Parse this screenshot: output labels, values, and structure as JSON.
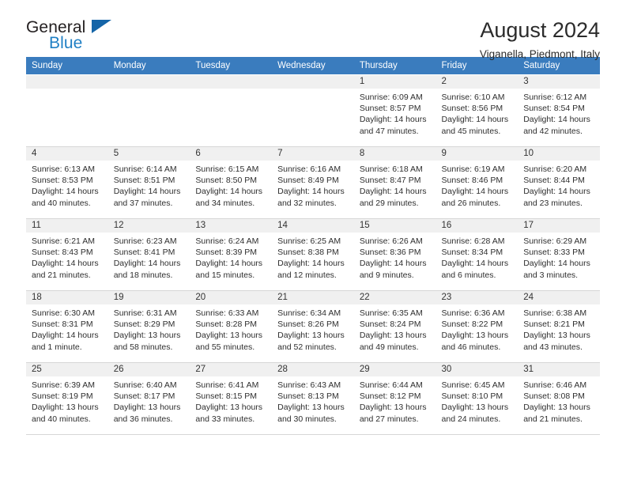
{
  "brand": {
    "name_part1": "General",
    "name_part2": "Blue",
    "flag_icon": "triangle-flag-icon"
  },
  "header": {
    "month_title": "August 2024",
    "location": "Viganella, Piedmont, Italy"
  },
  "colors": {
    "header_blue": "#3a7cbe",
    "brand_blue": "#1f7fc4",
    "flag_blue": "#1565a8",
    "daynum_bg": "#f0f0f0",
    "grid_line": "#d6d6d6"
  },
  "weekdays": [
    "Sunday",
    "Monday",
    "Tuesday",
    "Wednesday",
    "Thursday",
    "Friday",
    "Saturday"
  ],
  "weeks": [
    [
      {
        "empty": true,
        "day": "",
        "sunrise": "",
        "sunset": "",
        "daylight1": "",
        "daylight2": ""
      },
      {
        "empty": true,
        "day": "",
        "sunrise": "",
        "sunset": "",
        "daylight1": "",
        "daylight2": ""
      },
      {
        "empty": true,
        "day": "",
        "sunrise": "",
        "sunset": "",
        "daylight1": "",
        "daylight2": ""
      },
      {
        "empty": true,
        "day": "",
        "sunrise": "",
        "sunset": "",
        "daylight1": "",
        "daylight2": ""
      },
      {
        "empty": false,
        "day": "1",
        "sunrise": "Sunrise: 6:09 AM",
        "sunset": "Sunset: 8:57 PM",
        "daylight1": "Daylight: 14 hours",
        "daylight2": "and 47 minutes."
      },
      {
        "empty": false,
        "day": "2",
        "sunrise": "Sunrise: 6:10 AM",
        "sunset": "Sunset: 8:56 PM",
        "daylight1": "Daylight: 14 hours",
        "daylight2": "and 45 minutes."
      },
      {
        "empty": false,
        "day": "3",
        "sunrise": "Sunrise: 6:12 AM",
        "sunset": "Sunset: 8:54 PM",
        "daylight1": "Daylight: 14 hours",
        "daylight2": "and 42 minutes."
      }
    ],
    [
      {
        "empty": false,
        "day": "4",
        "sunrise": "Sunrise: 6:13 AM",
        "sunset": "Sunset: 8:53 PM",
        "daylight1": "Daylight: 14 hours",
        "daylight2": "and 40 minutes."
      },
      {
        "empty": false,
        "day": "5",
        "sunrise": "Sunrise: 6:14 AM",
        "sunset": "Sunset: 8:51 PM",
        "daylight1": "Daylight: 14 hours",
        "daylight2": "and 37 minutes."
      },
      {
        "empty": false,
        "day": "6",
        "sunrise": "Sunrise: 6:15 AM",
        "sunset": "Sunset: 8:50 PM",
        "daylight1": "Daylight: 14 hours",
        "daylight2": "and 34 minutes."
      },
      {
        "empty": false,
        "day": "7",
        "sunrise": "Sunrise: 6:16 AM",
        "sunset": "Sunset: 8:49 PM",
        "daylight1": "Daylight: 14 hours",
        "daylight2": "and 32 minutes."
      },
      {
        "empty": false,
        "day": "8",
        "sunrise": "Sunrise: 6:18 AM",
        "sunset": "Sunset: 8:47 PM",
        "daylight1": "Daylight: 14 hours",
        "daylight2": "and 29 minutes."
      },
      {
        "empty": false,
        "day": "9",
        "sunrise": "Sunrise: 6:19 AM",
        "sunset": "Sunset: 8:46 PM",
        "daylight1": "Daylight: 14 hours",
        "daylight2": "and 26 minutes."
      },
      {
        "empty": false,
        "day": "10",
        "sunrise": "Sunrise: 6:20 AM",
        "sunset": "Sunset: 8:44 PM",
        "daylight1": "Daylight: 14 hours",
        "daylight2": "and 23 minutes."
      }
    ],
    [
      {
        "empty": false,
        "day": "11",
        "sunrise": "Sunrise: 6:21 AM",
        "sunset": "Sunset: 8:43 PM",
        "daylight1": "Daylight: 14 hours",
        "daylight2": "and 21 minutes."
      },
      {
        "empty": false,
        "day": "12",
        "sunrise": "Sunrise: 6:23 AM",
        "sunset": "Sunset: 8:41 PM",
        "daylight1": "Daylight: 14 hours",
        "daylight2": "and 18 minutes."
      },
      {
        "empty": false,
        "day": "13",
        "sunrise": "Sunrise: 6:24 AM",
        "sunset": "Sunset: 8:39 PM",
        "daylight1": "Daylight: 14 hours",
        "daylight2": "and 15 minutes."
      },
      {
        "empty": false,
        "day": "14",
        "sunrise": "Sunrise: 6:25 AM",
        "sunset": "Sunset: 8:38 PM",
        "daylight1": "Daylight: 14 hours",
        "daylight2": "and 12 minutes."
      },
      {
        "empty": false,
        "day": "15",
        "sunrise": "Sunrise: 6:26 AM",
        "sunset": "Sunset: 8:36 PM",
        "daylight1": "Daylight: 14 hours",
        "daylight2": "and 9 minutes."
      },
      {
        "empty": false,
        "day": "16",
        "sunrise": "Sunrise: 6:28 AM",
        "sunset": "Sunset: 8:34 PM",
        "daylight1": "Daylight: 14 hours",
        "daylight2": "and 6 minutes."
      },
      {
        "empty": false,
        "day": "17",
        "sunrise": "Sunrise: 6:29 AM",
        "sunset": "Sunset: 8:33 PM",
        "daylight1": "Daylight: 14 hours",
        "daylight2": "and 3 minutes."
      }
    ],
    [
      {
        "empty": false,
        "day": "18",
        "sunrise": "Sunrise: 6:30 AM",
        "sunset": "Sunset: 8:31 PM",
        "daylight1": "Daylight: 14 hours",
        "daylight2": "and 1 minute."
      },
      {
        "empty": false,
        "day": "19",
        "sunrise": "Sunrise: 6:31 AM",
        "sunset": "Sunset: 8:29 PM",
        "daylight1": "Daylight: 13 hours",
        "daylight2": "and 58 minutes."
      },
      {
        "empty": false,
        "day": "20",
        "sunrise": "Sunrise: 6:33 AM",
        "sunset": "Sunset: 8:28 PM",
        "daylight1": "Daylight: 13 hours",
        "daylight2": "and 55 minutes."
      },
      {
        "empty": false,
        "day": "21",
        "sunrise": "Sunrise: 6:34 AM",
        "sunset": "Sunset: 8:26 PM",
        "daylight1": "Daylight: 13 hours",
        "daylight2": "and 52 minutes."
      },
      {
        "empty": false,
        "day": "22",
        "sunrise": "Sunrise: 6:35 AM",
        "sunset": "Sunset: 8:24 PM",
        "daylight1": "Daylight: 13 hours",
        "daylight2": "and 49 minutes."
      },
      {
        "empty": false,
        "day": "23",
        "sunrise": "Sunrise: 6:36 AM",
        "sunset": "Sunset: 8:22 PM",
        "daylight1": "Daylight: 13 hours",
        "daylight2": "and 46 minutes."
      },
      {
        "empty": false,
        "day": "24",
        "sunrise": "Sunrise: 6:38 AM",
        "sunset": "Sunset: 8:21 PM",
        "daylight1": "Daylight: 13 hours",
        "daylight2": "and 43 minutes."
      }
    ],
    [
      {
        "empty": false,
        "day": "25",
        "sunrise": "Sunrise: 6:39 AM",
        "sunset": "Sunset: 8:19 PM",
        "daylight1": "Daylight: 13 hours",
        "daylight2": "and 40 minutes."
      },
      {
        "empty": false,
        "day": "26",
        "sunrise": "Sunrise: 6:40 AM",
        "sunset": "Sunset: 8:17 PM",
        "daylight1": "Daylight: 13 hours",
        "daylight2": "and 36 minutes."
      },
      {
        "empty": false,
        "day": "27",
        "sunrise": "Sunrise: 6:41 AM",
        "sunset": "Sunset: 8:15 PM",
        "daylight1": "Daylight: 13 hours",
        "daylight2": "and 33 minutes."
      },
      {
        "empty": false,
        "day": "28",
        "sunrise": "Sunrise: 6:43 AM",
        "sunset": "Sunset: 8:13 PM",
        "daylight1": "Daylight: 13 hours",
        "daylight2": "and 30 minutes."
      },
      {
        "empty": false,
        "day": "29",
        "sunrise": "Sunrise: 6:44 AM",
        "sunset": "Sunset: 8:12 PM",
        "daylight1": "Daylight: 13 hours",
        "daylight2": "and 27 minutes."
      },
      {
        "empty": false,
        "day": "30",
        "sunrise": "Sunrise: 6:45 AM",
        "sunset": "Sunset: 8:10 PM",
        "daylight1": "Daylight: 13 hours",
        "daylight2": "and 24 minutes."
      },
      {
        "empty": false,
        "day": "31",
        "sunrise": "Sunrise: 6:46 AM",
        "sunset": "Sunset: 8:08 PM",
        "daylight1": "Daylight: 13 hours",
        "daylight2": "and 21 minutes."
      }
    ]
  ]
}
